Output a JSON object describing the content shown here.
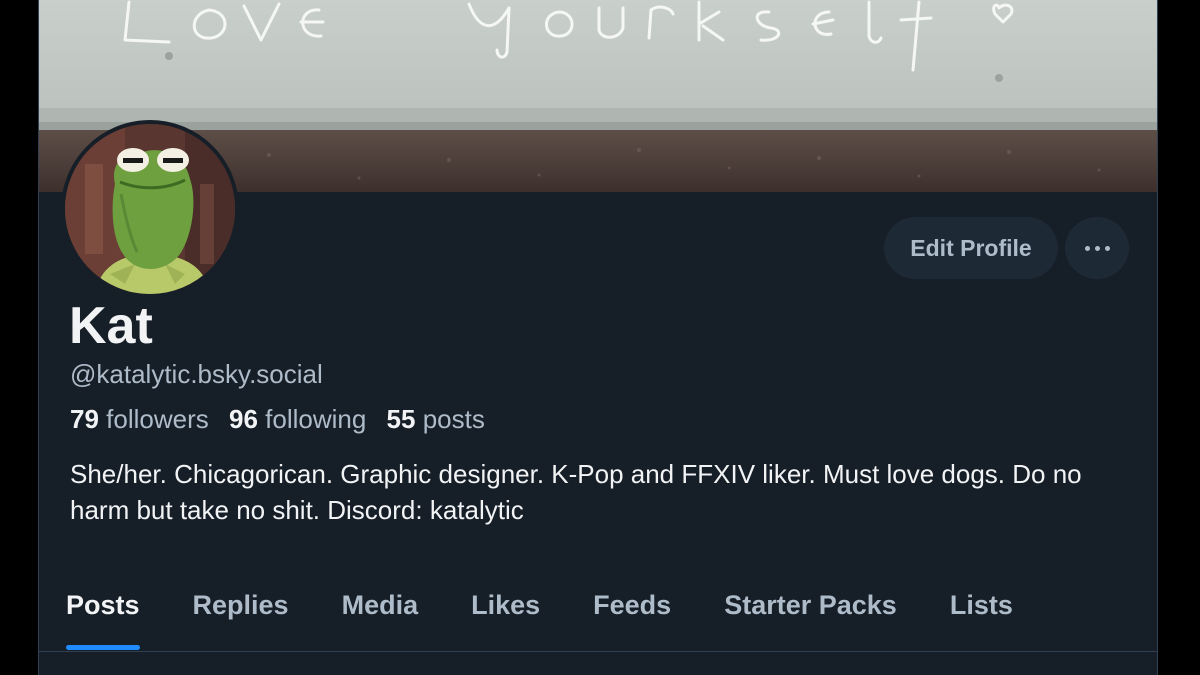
{
  "profile": {
    "display_name": "Kat",
    "handle": "@katalytic.bsky.social",
    "bio": "She/her. Chicagorican. Graphic designer. K-Pop and FFXIV liker. Must love dogs. Do no harm but take no shit. Discord: katalytic",
    "banner_text": "Love yourself",
    "avatar_icon": "frog-puppet-avatar"
  },
  "stats": {
    "followers_count": "79",
    "followers_label": "followers",
    "following_count": "96",
    "following_label": "following",
    "posts_count": "55",
    "posts_label": "posts"
  },
  "actions": {
    "edit_profile_label": "Edit Profile",
    "more_icon": "ellipsis-icon"
  },
  "tabs": [
    {
      "label": "Posts",
      "active": true
    },
    {
      "label": "Replies",
      "active": false
    },
    {
      "label": "Media",
      "active": false
    },
    {
      "label": "Likes",
      "active": false
    },
    {
      "label": "Feeds",
      "active": false
    },
    {
      "label": "Starter Packs",
      "active": false
    },
    {
      "label": "Lists",
      "active": false
    }
  ],
  "colors": {
    "background": "#161e27",
    "text_primary": "#f1f3f5",
    "text_secondary": "#aebbc9",
    "button_bg": "#1e2936",
    "accent": "#208bfe",
    "border": "#2e4052"
  }
}
